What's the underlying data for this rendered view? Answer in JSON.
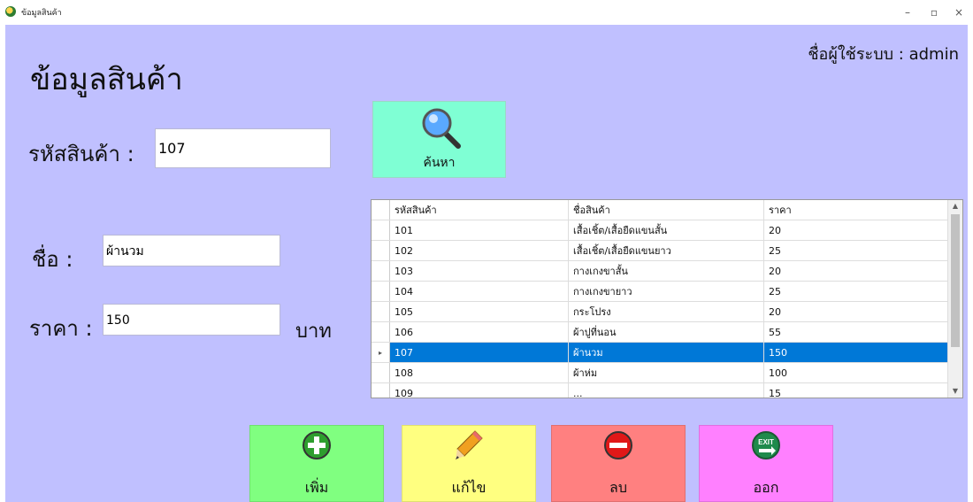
{
  "window": {
    "title": "ข้อมูลสินค้า",
    "minimize": "–",
    "maximize": "▫",
    "close": "×"
  },
  "header": {
    "title": "ข้อมูลสินค้า",
    "user_label": "ชื่อผู้ใช้ระบบ : admin"
  },
  "form": {
    "code_label": "รหัสสินค้า :",
    "code_value": "107",
    "name_label": "ชื่อ :",
    "name_value": "ผ้านวม",
    "price_label": "ราคา :",
    "price_value": "150",
    "unit_label": "บาท"
  },
  "search_button": {
    "label": "ค้นหา",
    "icon": "magnifier-icon"
  },
  "grid": {
    "columns": [
      "รหัสสินค้า",
      "ชื่อสินค้า",
      "ราคา"
    ],
    "rows": [
      [
        "101",
        "เสื้อเชิ้ต/เสื้อยืดแขนสั้น",
        "20"
      ],
      [
        "102",
        "เสื้อเชิ้ต/เสื้อยืดแขนยาว",
        "25"
      ],
      [
        "103",
        "กางเกงขาสั้น",
        "20"
      ],
      [
        "104",
        "กางเกงขายาว",
        "25"
      ],
      [
        "105",
        "กระโปรง",
        "20"
      ],
      [
        "106",
        "ผ้าปูที่นอน",
        "55"
      ],
      [
        "107",
        "ผ้านวม",
        "150"
      ],
      [
        "108",
        "ผ้าห่ม",
        "100"
      ],
      [
        "109",
        "...",
        "15"
      ]
    ],
    "selected_row": 6,
    "row_marker": "▸"
  },
  "actions": {
    "add": {
      "label": "เพิ่ม",
      "color": "#80ff80",
      "icon": "plus-circle-icon"
    },
    "edit": {
      "label": "แก้ไข",
      "color": "#ffff80",
      "icon": "pencil-icon"
    },
    "delete": {
      "label": "ลบ",
      "color": "#ff8080",
      "icon": "minus-circle-icon"
    },
    "exit": {
      "label": "ออก",
      "color": "#ff80ff",
      "icon": "exit-icon",
      "icon_text": "EXIT"
    }
  },
  "colors": {
    "background": "#c0c0ff",
    "selection": "#0078d7",
    "search": "#7fffd4"
  }
}
